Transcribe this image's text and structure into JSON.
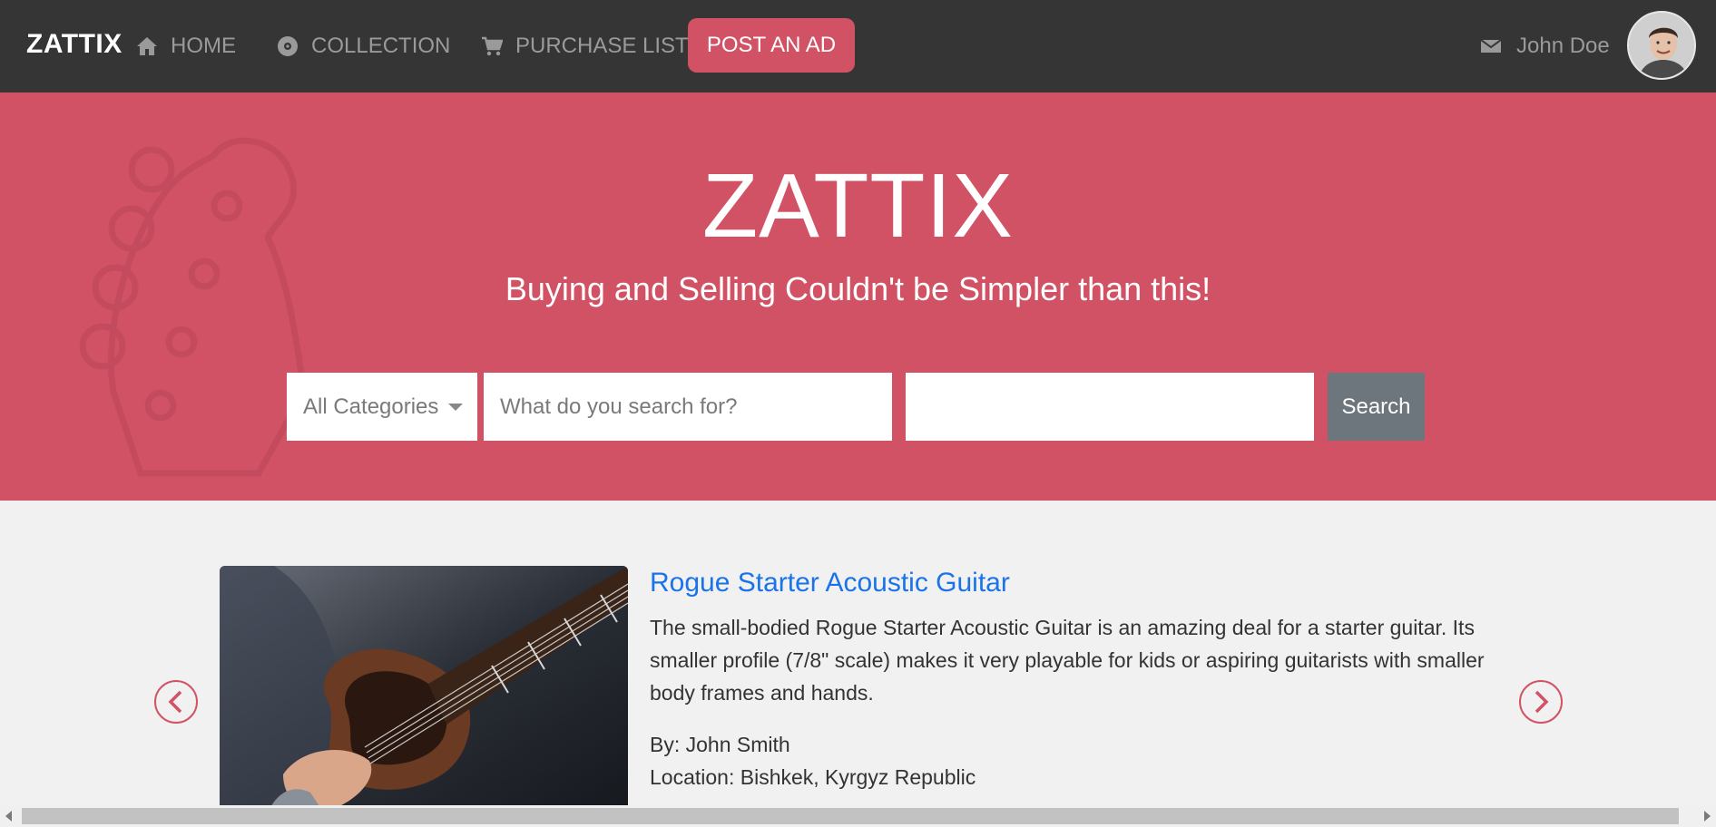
{
  "navbar": {
    "brand": "ZATTIX",
    "items": [
      {
        "label": "HOME",
        "icon": "home-icon"
      },
      {
        "label": "COLLECTION",
        "icon": "disc-icon"
      },
      {
        "label": "PURCHASE LIST",
        "icon": "cart-icon"
      }
    ],
    "post_ad_label": "POST AN AD",
    "user": {
      "name": "John Doe",
      "icon": "envelope-icon"
    }
  },
  "hero": {
    "title": "ZATTIX",
    "subtitle": "Buying and Selling Couldn't be Simpler than this!",
    "category_select": "All Categories",
    "query_placeholder": "What do you search for?",
    "location_value": "",
    "search_label": "Search"
  },
  "product": {
    "title": "Rogue Starter Acoustic Guitar",
    "description": "The small-bodied Rogue Starter Acoustic Guitar is an amazing deal for a starter guitar. Its smaller profile (7/8\" scale) makes it very playable for kids or aspiring guitarists with smaller body frames and hands.",
    "by": "By: John Smith",
    "location": "Location: Bishkek, Kyrgyz Republic"
  },
  "colors": {
    "accent": "#d25265",
    "navbar": "#353535",
    "link": "#1a73e8",
    "search_button": "#6d757d"
  }
}
